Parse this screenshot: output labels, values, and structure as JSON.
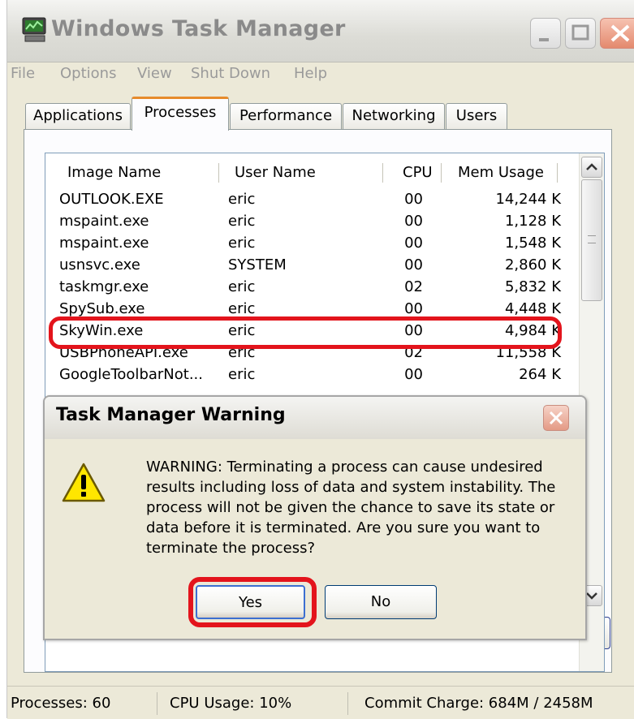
{
  "window": {
    "title": "Windows Task Manager",
    "menu": [
      "File",
      "Options",
      "View",
      "Shut Down",
      "Help"
    ]
  },
  "tabs": [
    {
      "label": "Applications",
      "active": false
    },
    {
      "label": "Processes",
      "active": true
    },
    {
      "label": "Performance",
      "active": false
    },
    {
      "label": "Networking",
      "active": false
    },
    {
      "label": "Users",
      "active": false
    }
  ],
  "process_list": {
    "columns": [
      "Image Name",
      "User Name",
      "CPU",
      "Mem Usage"
    ],
    "rows": [
      {
        "name": "OUTLOOK.EXE",
        "user": "eric",
        "cpu": "00",
        "mem": "14,244 K"
      },
      {
        "name": "mspaint.exe",
        "user": "eric",
        "cpu": "00",
        "mem": "1,128 K"
      },
      {
        "name": "mspaint.exe",
        "user": "eric",
        "cpu": "00",
        "mem": "1,548 K"
      },
      {
        "name": "usnsvc.exe",
        "user": "SYSTEM",
        "cpu": "00",
        "mem": "2,860 K"
      },
      {
        "name": "taskmgr.exe",
        "user": "eric",
        "cpu": "02",
        "mem": "5,832 K"
      },
      {
        "name": "SpySub.exe",
        "user": "eric",
        "cpu": "00",
        "mem": "4,448 K"
      },
      {
        "name": "SkyWin.exe",
        "user": "eric",
        "cpu": "00",
        "mem": "4,984 K"
      },
      {
        "name": "USBPhoneAPI.exe",
        "user": "eric",
        "cpu": "02",
        "mem": "11,558 K"
      },
      {
        "name": "GoogleToolbarNot...",
        "user": "eric",
        "cpu": "00",
        "mem": "264 K"
      }
    ],
    "highlighted_process": "SkyWin.exe"
  },
  "status_bar": {
    "processes": "Processes: 60",
    "cpu_usage": "CPU Usage: 10%",
    "commit_charge": "Commit Charge: 684M / 2458M"
  },
  "dialog": {
    "title": "Task Manager Warning",
    "message": "WARNING: Terminating a process can cause undesired results including loss of data and system instability. The process will not be given the chance to save its state or data before it is terminated.  Are you sure you want to terminate the process?",
    "yes_label": "Yes",
    "no_label": "No"
  },
  "colors": {
    "highlight": "#e3141c",
    "window_bg": "#ece9d8",
    "active_tab_accent": "#e68b2c"
  },
  "icons": [
    "task-manager-icon",
    "minimize-icon",
    "maximize-icon",
    "close-icon",
    "warning-icon",
    "scroll-up-icon",
    "scroll-down-icon"
  ]
}
